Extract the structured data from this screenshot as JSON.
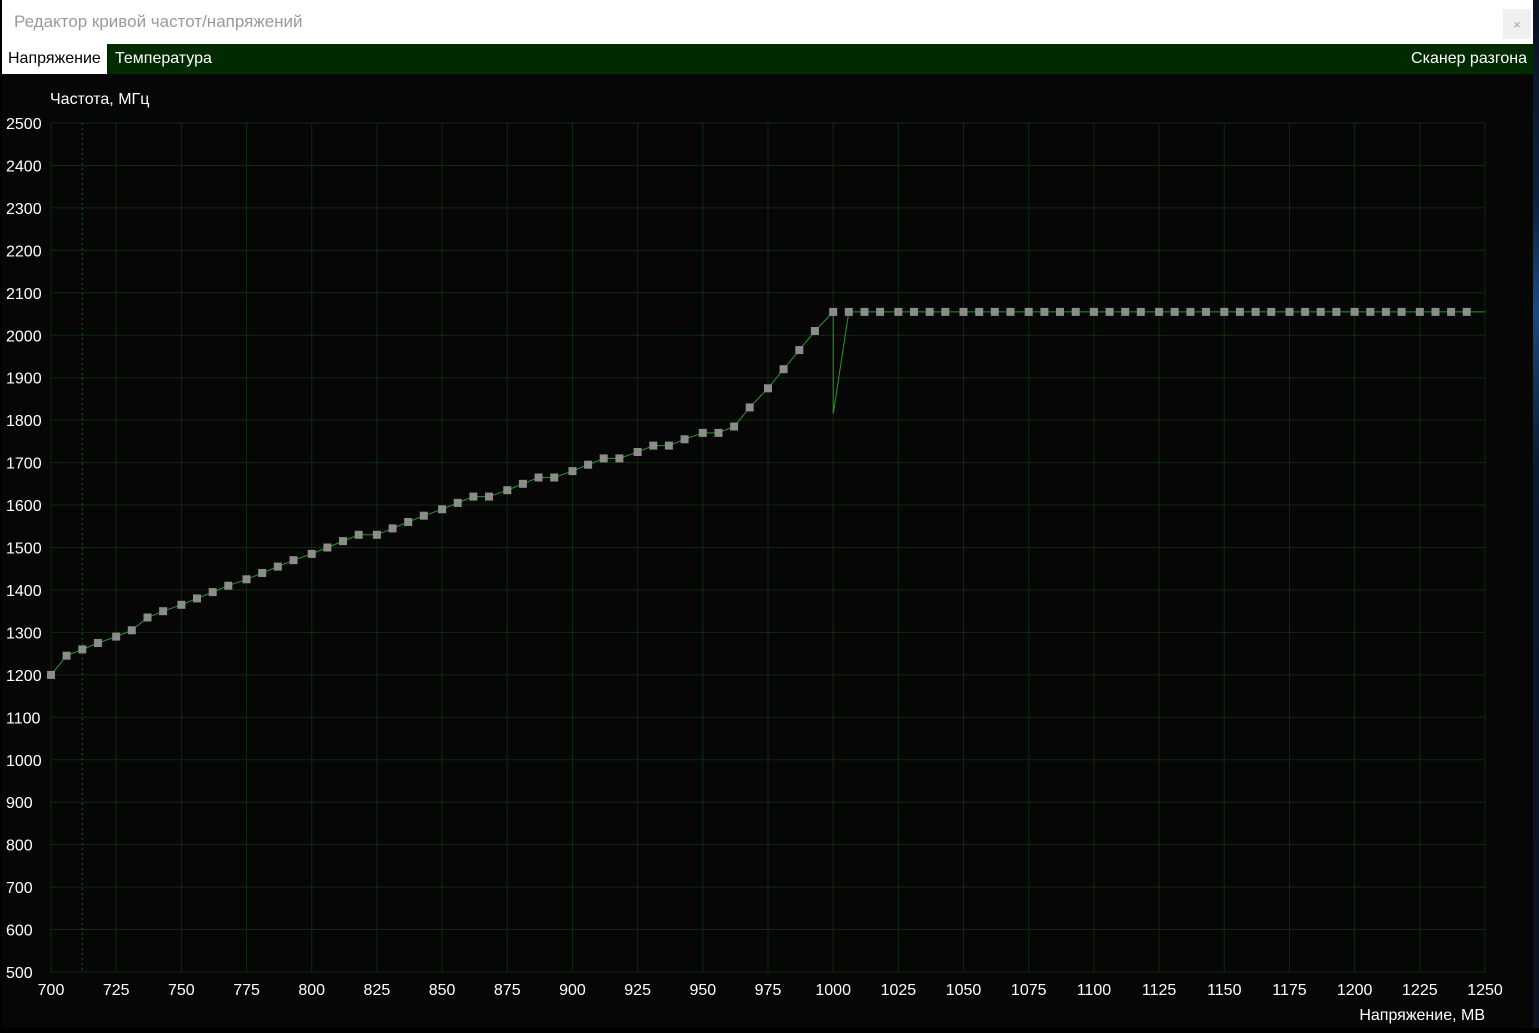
{
  "window": {
    "title": "Редактор кривой частот/напряжений",
    "close_glyph": "×"
  },
  "tabs": [
    {
      "label": "Напряжение",
      "active": true
    },
    {
      "label": "Температура",
      "active": false
    }
  ],
  "scanner_label": "Сканер разгона",
  "colors": {
    "tab_bar_bg": "#002a00",
    "grid": "#0f2a0f",
    "curve": "#1f9c1f",
    "point": "#8c8c8c",
    "text": "#ffffff"
  },
  "chart_data": {
    "type": "line",
    "ylabel": "Частота, МГц",
    "xlabel": "Напряжение, МВ",
    "xlim": [
      700,
      1250
    ],
    "ylim": [
      500,
      2500
    ],
    "x_ticks": [
      700,
      725,
      750,
      775,
      800,
      825,
      850,
      875,
      900,
      925,
      950,
      975,
      1000,
      1025,
      1050,
      1075,
      1100,
      1125,
      1150,
      1175,
      1200,
      1225,
      1250
    ],
    "y_ticks": [
      2500,
      2400,
      2300,
      2200,
      2100,
      2000,
      1900,
      1800,
      1700,
      1600,
      1500,
      1400,
      1300,
      1200,
      1100,
      1000,
      900,
      800,
      700,
      600,
      500
    ],
    "grid": true,
    "marker": 712,
    "curve": [
      [
        700,
        1200
      ],
      [
        706,
        1245
      ],
      [
        712,
        1260
      ],
      [
        718,
        1275
      ],
      [
        725,
        1290
      ],
      [
        731,
        1305
      ],
      [
        737,
        1335
      ],
      [
        743,
        1350
      ],
      [
        750,
        1365
      ],
      [
        756,
        1380
      ],
      [
        762,
        1395
      ],
      [
        768,
        1410
      ],
      [
        775,
        1425
      ],
      [
        781,
        1440
      ],
      [
        787,
        1455
      ],
      [
        793,
        1470
      ],
      [
        800,
        1485
      ],
      [
        806,
        1500
      ],
      [
        812,
        1515
      ],
      [
        818,
        1530
      ],
      [
        825,
        1530
      ],
      [
        831,
        1545
      ],
      [
        837,
        1560
      ],
      [
        843,
        1575
      ],
      [
        850,
        1590
      ],
      [
        856,
        1605
      ],
      [
        862,
        1620
      ],
      [
        868,
        1620
      ],
      [
        875,
        1635
      ],
      [
        881,
        1650
      ],
      [
        887,
        1665
      ],
      [
        893,
        1665
      ],
      [
        900,
        1680
      ],
      [
        906,
        1695
      ],
      [
        912,
        1710
      ],
      [
        918,
        1710
      ],
      [
        925,
        1725
      ],
      [
        931,
        1740
      ],
      [
        937,
        1740
      ],
      [
        943,
        1755
      ],
      [
        950,
        1770
      ],
      [
        956,
        1770
      ],
      [
        962,
        1785
      ],
      [
        968,
        1830
      ],
      [
        975,
        1875
      ],
      [
        981,
        1920
      ],
      [
        987,
        1965
      ],
      [
        993,
        2010
      ],
      [
        1000,
        2055
      ],
      [
        1000,
        1815
      ],
      [
        1006,
        2055
      ],
      [
        1250,
        2055
      ]
    ],
    "points": [
      [
        700,
        1200
      ],
      [
        706,
        1245
      ],
      [
        712,
        1260
      ],
      [
        718,
        1275
      ],
      [
        725,
        1290
      ],
      [
        731,
        1305
      ],
      [
        737,
        1335
      ],
      [
        743,
        1350
      ],
      [
        750,
        1365
      ],
      [
        756,
        1380
      ],
      [
        762,
        1395
      ],
      [
        768,
        1410
      ],
      [
        775,
        1425
      ],
      [
        781,
        1440
      ],
      [
        787,
        1455
      ],
      [
        793,
        1470
      ],
      [
        800,
        1485
      ],
      [
        806,
        1500
      ],
      [
        812,
        1515
      ],
      [
        818,
        1530
      ],
      [
        825,
        1530
      ],
      [
        831,
        1545
      ],
      [
        837,
        1560
      ],
      [
        843,
        1575
      ],
      [
        850,
        1590
      ],
      [
        856,
        1605
      ],
      [
        862,
        1620
      ],
      [
        868,
        1620
      ],
      [
        875,
        1635
      ],
      [
        881,
        1650
      ],
      [
        887,
        1665
      ],
      [
        893,
        1665
      ],
      [
        900,
        1680
      ],
      [
        906,
        1695
      ],
      [
        912,
        1710
      ],
      [
        918,
        1710
      ],
      [
        925,
        1725
      ],
      [
        931,
        1740
      ],
      [
        937,
        1740
      ],
      [
        943,
        1755
      ],
      [
        950,
        1770
      ],
      [
        956,
        1770
      ],
      [
        962,
        1785
      ],
      [
        968,
        1830
      ],
      [
        975,
        1875
      ],
      [
        981,
        1920
      ],
      [
        987,
        1965
      ],
      [
        993,
        2010
      ],
      [
        1000,
        2055
      ],
      [
        1006,
        2055
      ],
      [
        1012,
        2055
      ],
      [
        1018,
        2055
      ],
      [
        1025,
        2055
      ],
      [
        1031,
        2055
      ],
      [
        1037,
        2055
      ],
      [
        1043,
        2055
      ],
      [
        1050,
        2055
      ],
      [
        1056,
        2055
      ],
      [
        1062,
        2055
      ],
      [
        1068,
        2055
      ],
      [
        1075,
        2055
      ],
      [
        1081,
        2055
      ],
      [
        1087,
        2055
      ],
      [
        1093,
        2055
      ],
      [
        1100,
        2055
      ],
      [
        1106,
        2055
      ],
      [
        1112,
        2055
      ],
      [
        1118,
        2055
      ],
      [
        1125,
        2055
      ],
      [
        1131,
        2055
      ],
      [
        1137,
        2055
      ],
      [
        1143,
        2055
      ],
      [
        1150,
        2055
      ],
      [
        1156,
        2055
      ],
      [
        1162,
        2055
      ],
      [
        1168,
        2055
      ],
      [
        1175,
        2055
      ],
      [
        1181,
        2055
      ],
      [
        1187,
        2055
      ],
      [
        1193,
        2055
      ],
      [
        1200,
        2055
      ],
      [
        1206,
        2055
      ],
      [
        1212,
        2055
      ],
      [
        1218,
        2055
      ],
      [
        1225,
        2055
      ],
      [
        1231,
        2055
      ],
      [
        1237,
        2055
      ],
      [
        1243,
        2055
      ]
    ]
  }
}
